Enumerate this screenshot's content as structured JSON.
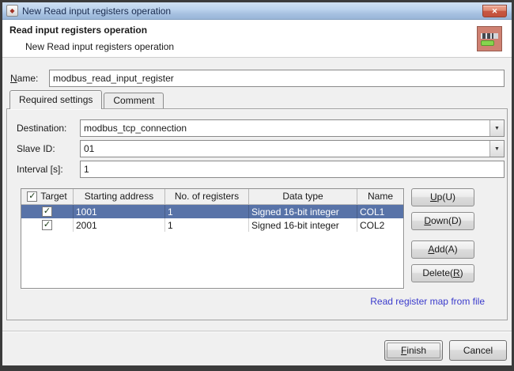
{
  "window": {
    "title": "New Read input registers operation"
  },
  "header": {
    "title": "Read input registers operation",
    "subtitle": "New Read input registers operation"
  },
  "name_field": {
    "label": {
      "mn": "N",
      "post": "ame:"
    },
    "value": "modbus_read_input_register"
  },
  "tabs": [
    {
      "label": "Required settings"
    },
    {
      "label": "Comment"
    }
  ],
  "fields": {
    "destination": {
      "label": "Destination:",
      "value": "modbus_tcp_connection"
    },
    "slave_id": {
      "label": "Slave ID:",
      "value": "01"
    },
    "interval": {
      "label": "Interval [s]:",
      "value": "1"
    }
  },
  "table": {
    "headers": {
      "target": "Target",
      "starting_address": "Starting address",
      "no_of_registers": "No. of registers",
      "data_type": "Data type",
      "name": "Name"
    },
    "rows": [
      {
        "starting_address": "1001",
        "no_of_registers": "1",
        "data_type": "Signed 16-bit integer",
        "name": "COL1"
      },
      {
        "starting_address": "2001",
        "no_of_registers": "1",
        "data_type": "Signed 16-bit integer",
        "name": "COL2"
      }
    ]
  },
  "side_buttons": {
    "up": {
      "pre": "",
      "mn": "U",
      "post": "p(U)"
    },
    "down": {
      "pre": "",
      "mn": "D",
      "post": "own(D)"
    },
    "add": {
      "pre": "",
      "mn": "A",
      "post": "dd(A)"
    },
    "delete": {
      "pre": "Delete(",
      "mn": "R",
      "post": ")"
    }
  },
  "link": {
    "label": "Read register map from file"
  },
  "footer": {
    "finish": {
      "mn": "F",
      "post": "inish"
    },
    "cancel": "Cancel"
  },
  "icons": {
    "close": "✕",
    "dropdown": "▼",
    "check": "✓",
    "app": "◆"
  },
  "colors": {
    "selection": "#5873a8",
    "link": "#3b3bcc",
    "titlebar_top": "#cfe0f2",
    "titlebar_bottom": "#9ab6d8",
    "header_icon_bg": "#ce8172"
  }
}
